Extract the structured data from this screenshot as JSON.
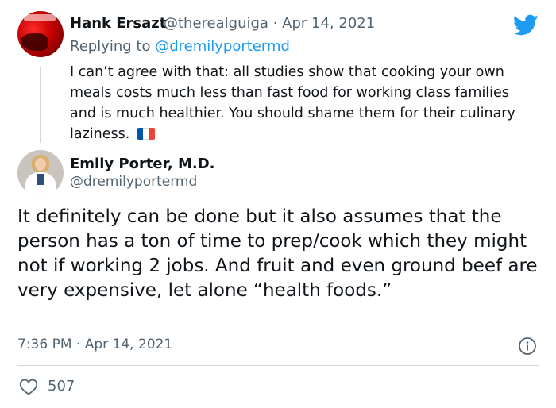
{
  "reply_tweet": {
    "author_name": "Hank Ersazt",
    "handle": "@therealguiga",
    "separator": "·",
    "date": "Apr 14, 2021",
    "replying_prefix": "Replying to",
    "replying_to": "@dremilyportermd",
    "text": "I can’t agree with that: all studies show that cooking your own meals costs much less than fast food for working class families and is much healthier. You should shame them for their culinary laziness.",
    "flag_emoji": "france-flag-icon",
    "flag_colors": [
      "#0055a4",
      "#ffffff",
      "#ef4135"
    ]
  },
  "main_tweet": {
    "author_name": "Emily Porter, M.D.",
    "handle": "@dremilyportermd",
    "text": "It definitely can be done but it also assumes that the person has a ton of time to prep/cook which they might not if working 2 jobs. And fruit and even ground beef are very expensive, let alone “health foods.”",
    "time": "7:36 PM",
    "separator": "·",
    "date": "Apr 14, 2021",
    "likes": "507"
  },
  "icons": {
    "brand": "twitter-bird-icon",
    "info": "info-icon",
    "like": "heart-icon"
  },
  "colors": {
    "accent": "#1d9bf0",
    "secondary_text": "#536471",
    "primary_text": "#0f1419",
    "divider": "#cfd9de"
  }
}
